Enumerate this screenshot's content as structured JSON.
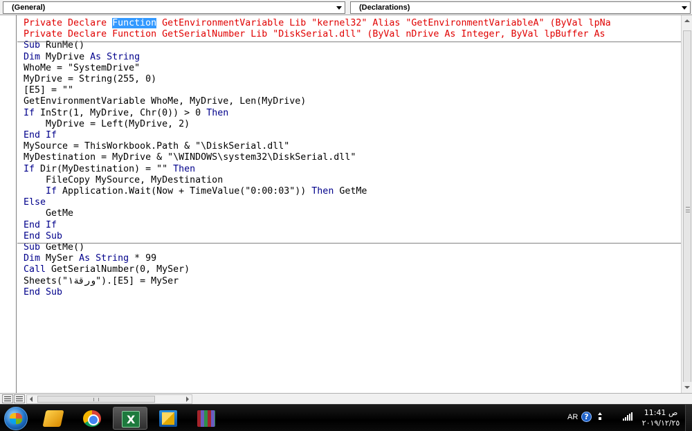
{
  "object_combo": {
    "value": "(General)"
  },
  "procedure_combo": {
    "value": "(Declarations)"
  },
  "code": {
    "declarations": [
      [
        {
          "t": "Private Declare ",
          "c": "red"
        },
        {
          "t": "Function",
          "c": "sel"
        },
        {
          "t": " GetEnvironmentVariable Lib \"kernel32\" Alias \"GetEnvironmentVariableA\" (ByVal lpNa",
          "c": "red"
        }
      ],
      [
        {
          "t": "Private Declare Function GetSerialNumber Lib \"DiskSerial.dll\" (ByVal nDrive As Integer, ByVal lpBuffer As",
          "c": "red"
        }
      ]
    ],
    "runme": [
      [
        {
          "t": "Sub",
          "c": "kw"
        },
        {
          "t": " RunMe()"
        }
      ],
      [
        {
          "t": "Dim",
          "c": "kw"
        },
        {
          "t": " MyDrive "
        },
        {
          "t": "As",
          "c": "kw"
        },
        {
          "t": " "
        },
        {
          "t": "String",
          "c": "kw"
        }
      ],
      [
        {
          "t": "WhoMe = \"SystemDrive\""
        }
      ],
      [
        {
          "t": "MyDrive = String(255, 0)"
        }
      ],
      [
        {
          "t": "[E5] = \"\""
        }
      ],
      [
        {
          "t": "GetEnvironmentVariable WhoMe, MyDrive, Len(MyDrive)"
        }
      ],
      [
        {
          "t": "If",
          "c": "kw"
        },
        {
          "t": " InStr(1, MyDrive, Chr(0)) > 0 "
        },
        {
          "t": "Then",
          "c": "kw"
        }
      ],
      [
        {
          "t": "    MyDrive = Left(MyDrive, 2)"
        }
      ],
      [
        {
          "t": "End",
          "c": "kw"
        },
        {
          "t": " "
        },
        {
          "t": "If",
          "c": "kw"
        }
      ],
      [
        {
          "t": "MySource = ThisWorkbook.Path & \"\\DiskSerial.dll\""
        }
      ],
      [
        {
          "t": "MyDestination = MyDrive & \"\\WINDOWS\\system32\\DiskSerial.dll\""
        }
      ],
      [
        {
          "t": "If",
          "c": "kw"
        },
        {
          "t": " Dir(MyDestination) = \"\" "
        },
        {
          "t": "Then",
          "c": "kw"
        }
      ],
      [
        {
          "t": "    FileCopy MySource, MyDestination"
        }
      ],
      [
        {
          "t": "    "
        },
        {
          "t": "If",
          "c": "kw"
        },
        {
          "t": " Application.Wait(Now + TimeValue(\"0:00:03\")) "
        },
        {
          "t": "Then",
          "c": "kw"
        },
        {
          "t": " GetMe"
        }
      ],
      [
        {
          "t": "Else",
          "c": "kw"
        }
      ],
      [
        {
          "t": "    GetMe"
        }
      ],
      [
        {
          "t": "End",
          "c": "kw"
        },
        {
          "t": " "
        },
        {
          "t": "If",
          "c": "kw"
        }
      ],
      [
        {
          "t": "End",
          "c": "kw"
        },
        {
          "t": " "
        },
        {
          "t": "Sub",
          "c": "kw"
        }
      ]
    ],
    "getme": [
      [
        {
          "t": "Sub",
          "c": "kw"
        },
        {
          "t": " GetMe()"
        }
      ],
      [
        {
          "t": "Dim",
          "c": "kw"
        },
        {
          "t": " MySer "
        },
        {
          "t": "As",
          "c": "kw"
        },
        {
          "t": " "
        },
        {
          "t": "String",
          "c": "kw"
        },
        {
          "t": " * 99"
        }
      ],
      [
        {
          "t": "Call",
          "c": "kw"
        },
        {
          "t": " GetSerialNumber(0, MySer)"
        }
      ],
      [
        {
          "t": "Sheets(\"ورقة١\").[E5] = MySer"
        }
      ],
      [
        {
          "t": "End",
          "c": "kw"
        },
        {
          "t": " "
        },
        {
          "t": "Sub",
          "c": "kw"
        }
      ]
    ]
  },
  "taskbar": {
    "apps": [
      {
        "icon": "utility-tool-icon"
      },
      {
        "icon": "chrome-icon"
      },
      {
        "icon": "excel-icon",
        "active": true
      },
      {
        "icon": "installer-icon"
      },
      {
        "icon": "winrar-icon"
      }
    ],
    "language": "AR",
    "clock_period": "ص",
    "clock_time": "11:41",
    "clock_date": "٢٠١٩/١٢/٢٥"
  },
  "colors": {
    "keyword": "#00008b",
    "error": "#e00000",
    "selection": "#3399ff"
  }
}
